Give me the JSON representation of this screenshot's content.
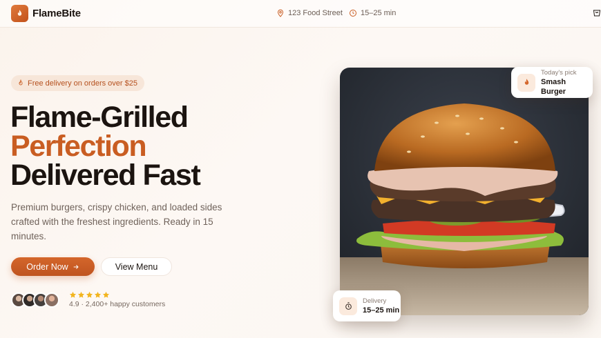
{
  "header": {
    "brand": "FlameBite",
    "address": "123 Food Street",
    "delivery_time": "15–25 min",
    "icons": [
      "flame-icon",
      "map-pin-icon",
      "clock-icon",
      "cart-icon"
    ]
  },
  "hero": {
    "promo": "Free delivery on orders over $25",
    "headline_line1": "Flame-Grilled",
    "headline_line2": "Perfection",
    "headline_line3": "Delivered Fast",
    "subtitle": "Premium burgers, crispy chicken, and loaded sides crafted with the freshest ingredients. Ready in 15 minutes.",
    "primary_cta": "Order Now",
    "secondary_cta": "View Menu",
    "rating": {
      "stars": 5,
      "text": "4.9 · 2,400+ happy customers"
    }
  },
  "cards": {
    "pick_label": "Today's pick",
    "pick_value": "Smash Burger",
    "delivery_label": "Delivery",
    "delivery_value": "15–25 min"
  },
  "colors": {
    "accent": "#c95d22",
    "accent_button": "#d4662b",
    "text_dark": "#1b1410",
    "star": "#f2b51f"
  }
}
